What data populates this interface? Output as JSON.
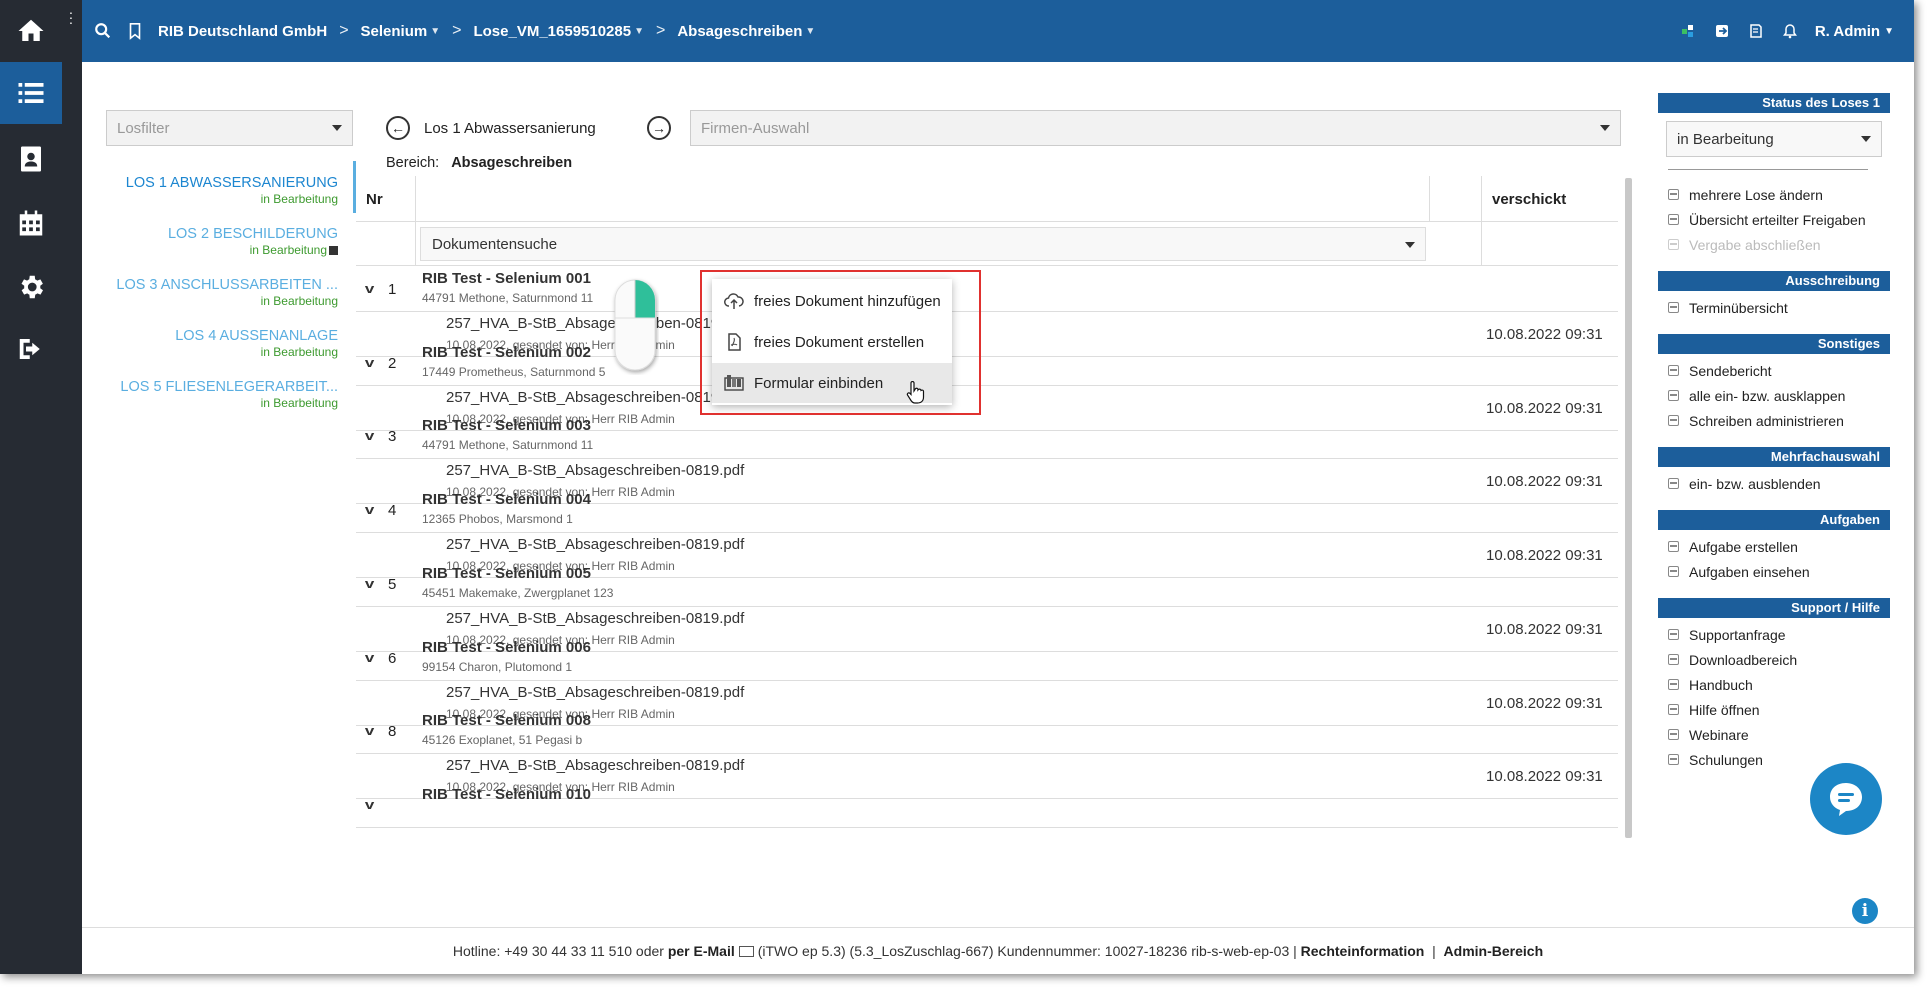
{
  "nav": {
    "icons": [
      "home-icon",
      "list-icon",
      "contacts-icon",
      "calendar-icon",
      "gear-icon",
      "logout-icon"
    ]
  },
  "topbar": {
    "crumbs": [
      "RIB Deutschland GmbH",
      "Selenium",
      "Lose_VM_1659510285",
      "Absageschreiben"
    ],
    "user": "R. Admin"
  },
  "losfilter": {
    "placeholder": "Losfilter"
  },
  "lots": [
    {
      "title": "LOS 1 ABWASSERSANIERUNG",
      "status": "in Bearbeitung"
    },
    {
      "title": "LOS 2 BESCHILDERUNG",
      "status": "in Bearbeitung"
    },
    {
      "title": "LOS 3 ANSCHLUSSARBEITEN ...",
      "status": "in Bearbeitung"
    },
    {
      "title": "LOS 4 AUSSENANLAGE",
      "status": "in Bearbeitung"
    },
    {
      "title": "LOS 5 FLIESENLEGERARBEIT...",
      "status": "in Bearbeitung"
    }
  ],
  "losnav": {
    "title": "Los 1 Abwassersanierung"
  },
  "firmen": {
    "placeholder": "Firmen-Auswahl"
  },
  "bereich": {
    "label": "Bereich:",
    "value": "Absageschreiben"
  },
  "table": {
    "col_nr": "Nr",
    "col_sent": "verschickt",
    "docsearch": "Dokumentensuche",
    "groups": [
      {
        "nr": "1",
        "name": "RIB Test - Selenium 001",
        "addr": "44791 Methone, Saturnmond 11",
        "file": "257_HVA_B-StB_Absageschreiben-0819.pdf",
        "meta": "10.08.2022, gesendet von: Herr RIB Admin",
        "date": "10.08.2022 09:31"
      },
      {
        "nr": "2",
        "name": "RIB Test - Selenium 002",
        "addr": "17449 Prometheus, Saturnmond 5",
        "file": "257_HVA_B-StB_Absageschreiben-0819.pdf",
        "meta": "10.08.2022, gesendet von: Herr RIB Admin",
        "date": "10.08.2022 09:31"
      },
      {
        "nr": "3",
        "name": "RIB Test - Selenium 003",
        "addr": "44791 Methone, Saturnmond 11",
        "file": "257_HVA_B-StB_Absageschreiben-0819.pdf",
        "meta": "10.08.2022, gesendet von: Herr RIB Admin",
        "date": "10.08.2022 09:31"
      },
      {
        "nr": "4",
        "name": "RIB Test - Selenium 004",
        "addr": "12365 Phobos, Marsmond 1",
        "file": "257_HVA_B-StB_Absageschreiben-0819.pdf",
        "meta": "10.08.2022, gesendet von: Herr RIB Admin",
        "date": "10.08.2022 09:31"
      },
      {
        "nr": "5",
        "name": "RIB Test - Selenium 005",
        "addr": "45451 Makemake, Zwergplanet 123",
        "file": "257_HVA_B-StB_Absageschreiben-0819.pdf",
        "meta": "10.08.2022, gesendet von: Herr RIB Admin",
        "date": "10.08.2022 09:31"
      },
      {
        "nr": "6",
        "name": "RIB Test - Selenium 006",
        "addr": "99154 Charon, Plutomond 1",
        "file": "257_HVA_B-StB_Absageschreiben-0819.pdf",
        "meta": "10.08.2022, gesendet von: Herr RIB Admin",
        "date": "10.08.2022 09:31"
      },
      {
        "nr": "8",
        "name": "RIB Test - Selenium 008",
        "addr": "45126 Exoplanet, 51 Pegasi b",
        "file": "257_HVA_B-StB_Absageschreiben-0819.pdf",
        "meta": "10.08.2022, gesendet von: Herr RIB Admin",
        "date": "10.08.2022 09:31"
      },
      {
        "nr": "",
        "name": "RIB Test - Selenium 010",
        "addr": "",
        "file": "",
        "meta": "",
        "date": ""
      }
    ]
  },
  "context_menu": {
    "items": [
      {
        "label": "freies Dokument hinzufügen",
        "icon": "cloud-upload-icon"
      },
      {
        "label": "freies Dokument erstellen",
        "icon": "pdf-file-icon"
      },
      {
        "label": "Formular einbinden",
        "icon": "form-icon"
      }
    ],
    "highlight_color": "#e0312f"
  },
  "sidebar": {
    "status_header": "Status des Loses 1",
    "status_value": "in Bearbeitung",
    "status_items": [
      "mehrere Lose ändern",
      "Übersicht erteilter Freigaben",
      "Vergabe abschließen"
    ],
    "sections": [
      {
        "header": "Ausschreibung",
        "items": [
          "Terminübersicht"
        ]
      },
      {
        "header": "Sonstiges",
        "items": [
          "Sendebericht",
          "alle ein- bzw. ausklappen",
          "Schreiben administrieren"
        ]
      },
      {
        "header": "Mehrfachauswahl",
        "items": [
          "ein- bzw. ausblenden"
        ]
      },
      {
        "header": "Aufgaben",
        "items": [
          "Aufgabe erstellen",
          "Aufgaben einsehen"
        ]
      },
      {
        "header": "Support / Hilfe",
        "items": [
          "Supportanfrage",
          "Downloadbereich",
          "Handbuch",
          "Hilfe öffnen",
          "Webinare",
          "Schulungen"
        ]
      }
    ]
  },
  "footer": {
    "hotline": "Hotline: +49 30 44 33 11 510 oder",
    "email": "per E-Mail",
    "version": "(iTWO ep 5.3) (5.3_LosZuschlag-667)   Kundennummer: 10027-18236 rib-s-web-ep-03 |",
    "legal": "Rechteinformation",
    "divider": "|",
    "admin": "Admin-Bereich"
  },
  "colors": {
    "brand": "#1c5e9b",
    "sidebar_dark": "#262b33",
    "status_green": "#3d9a2f",
    "lot_blue": "#5aaee0"
  }
}
